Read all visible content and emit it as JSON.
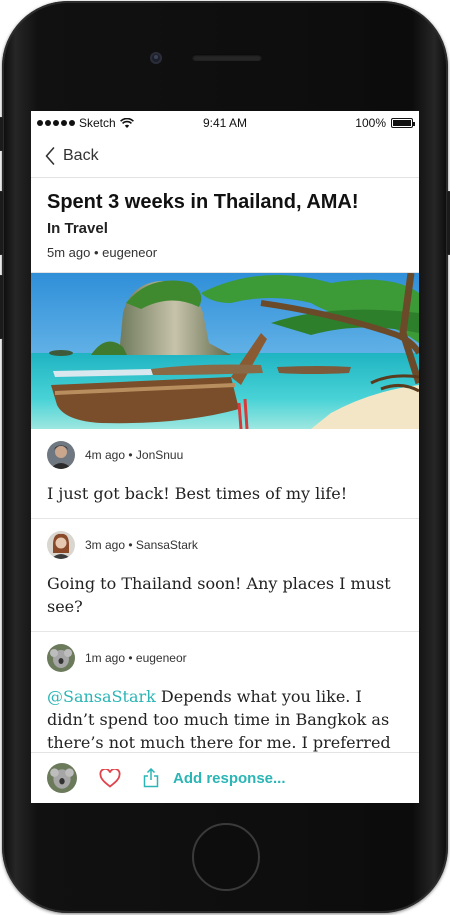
{
  "status_bar": {
    "carrier": "Sketch",
    "time": "9:41 AM",
    "battery": "100%"
  },
  "nav": {
    "back_label": "Back"
  },
  "post": {
    "title": "Spent 3 weeks in Thailand, AMA!",
    "category": "In Travel",
    "meta": "5m ago • eugeneor"
  },
  "comments": [
    {
      "meta": "4m ago • JonSnuu",
      "text": "I just got back! Best times of my life!"
    },
    {
      "meta": "3m ago • SansaStark",
      "text": "Going to Thailand soon! Any places I must see?"
    },
    {
      "meta": "1m ago • eugeneor",
      "mention": "@SansaStark",
      "text": " Depends what you like. I didn’t spend too much time in Bangkok as there’s not much there for me. I preferred being away from the city and spent more time on the islands."
    }
  ],
  "bottom_bar": {
    "add_label": "Add response..."
  },
  "colors": {
    "accent": "#2bb5b5",
    "heart": "#e0434b"
  }
}
